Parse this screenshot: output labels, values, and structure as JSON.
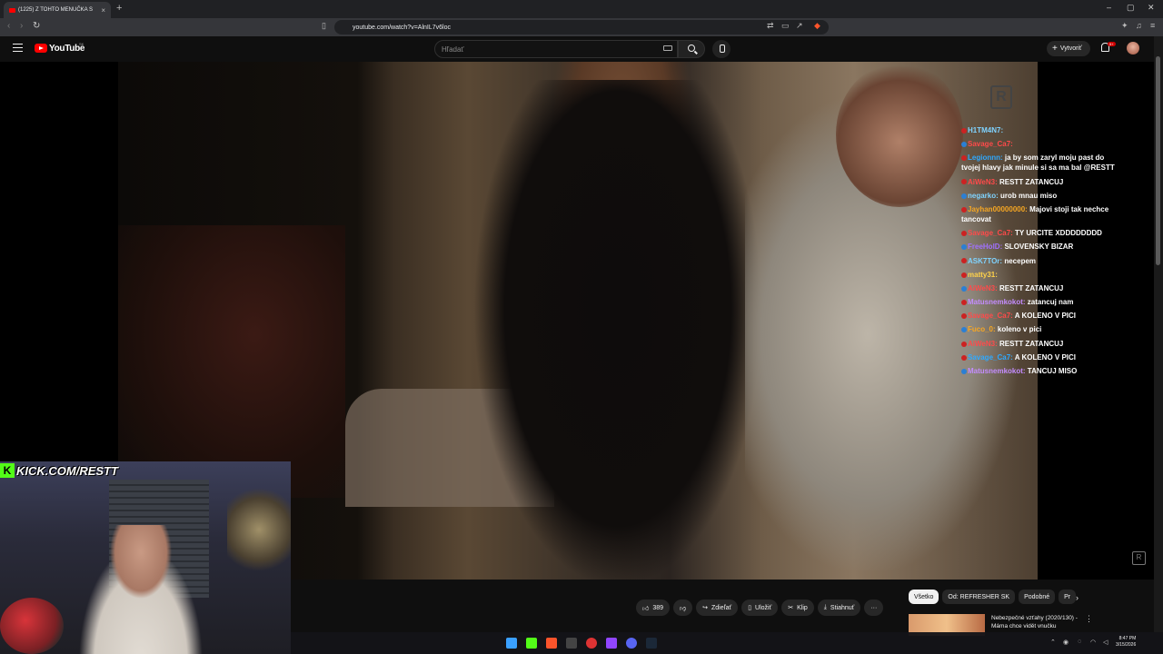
{
  "browser": {
    "tab_title": "(1225) Z TOHTO MENUČKA S",
    "url": "youtube.com/watch?v=AlnIL7v6loc",
    "new_tab": "+",
    "win_min": "–",
    "win_max": "▢",
    "win_close": "✕"
  },
  "youtube": {
    "logo_text": "YouTube",
    "country_code": "SK",
    "search_placeholder": "Hľadať",
    "create_label": "Vytvoriť",
    "notification_badge": "9+"
  },
  "overlay": {
    "kick_k": "K",
    "kick_text": "KICK.COM/RESTT",
    "watermark": "R"
  },
  "chat": [
    {
      "name": "H1TM4N7:",
      "color": "#7fd3ff",
      "msg": ""
    },
    {
      "name": "Savage_Ca7:",
      "color": "#ff4a4a",
      "msg": ""
    },
    {
      "name": "Legionnn:",
      "color": "#2ea9ff",
      "msg": "ja by som zaryl moju past do tvojej hlavy jak minule si sa ma bal @RESTT"
    },
    {
      "name": "AiWeN3:",
      "color": "#ff4a4a",
      "msg": "RESTT ZATANCUJ"
    },
    {
      "name": "negarko:",
      "color": "#7fd3ff",
      "msg": "urob mnau miso"
    },
    {
      "name": "Jayhan00000000:",
      "color": "#f5a623",
      "msg": "Majovi stoji tak nechce tancovat"
    },
    {
      "name": "Savage_Ca7:",
      "color": "#ff4a4a",
      "msg": "TY URCITE XDDDDDDDD"
    },
    {
      "name": "FreeHolD:",
      "color": "#a070ff",
      "msg": "SLOVENSKY BIZAR"
    },
    {
      "name": "ASK7TOr:",
      "color": "#7fd3ff",
      "msg": "necepem"
    },
    {
      "name": "matty31:",
      "color": "#ffd24a",
      "msg": ""
    },
    {
      "name": "AiWeN3:",
      "color": "#ff4a4a",
      "msg": "RESTT ZATANCUJ"
    },
    {
      "name": "Matusnemkokot:",
      "color": "#c48cff",
      "msg": "zatancuj nam"
    },
    {
      "name": "Savage_Ca7:",
      "color": "#ff4a4a",
      "msg": "A KOLENO V PICI"
    },
    {
      "name": "Fuco_0:",
      "color": "#f5a623",
      "msg": "koleno v pici"
    },
    {
      "name": "AiWeN3:",
      "color": "#ff4a4a",
      "msg": "RESTT ZATANCUJ"
    },
    {
      "name": "Savage_Ca7:",
      "color": "#2ea9ff",
      "msg": "A KOLENO V PICI"
    },
    {
      "name": "Matusnemkokot:",
      "color": "#c48cff",
      "msg": "TANCUJ MISO"
    }
  ],
  "actions": {
    "like_count": "389",
    "share": "Zdieľať",
    "save": "Uložiť",
    "clip": "Klip",
    "download": "Stiahnuť",
    "more": "···"
  },
  "chips": [
    {
      "label": "Všetko",
      "active": true
    },
    {
      "label": "Od: REFRESHER SK",
      "active": false
    },
    {
      "label": "Podobné",
      "active": false
    },
    {
      "label": "Pr",
      "active": false
    }
  ],
  "chip_next": "›",
  "recommendation": {
    "title": "Nebezpečné vzťahy (2020/130) - Máma chce vidět vnučku",
    "more": "⋮"
  },
  "taskbar": {
    "time": "8:47 PM",
    "date": "3/15/2026"
  },
  "colors": {
    "youtube_red": "#ff0000",
    "kick_green": "#53fc18",
    "background": "#0f0f0f"
  }
}
